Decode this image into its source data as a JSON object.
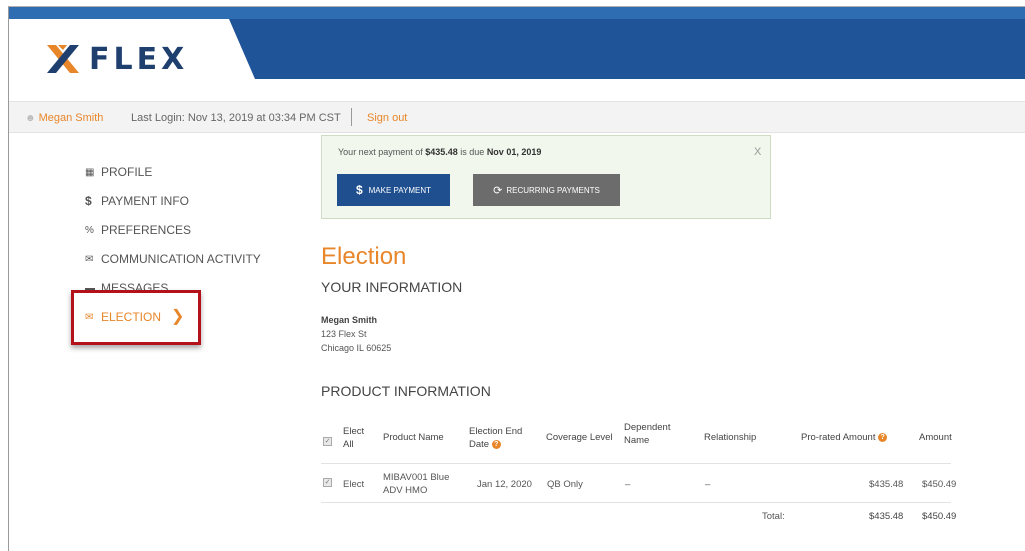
{
  "brand": {
    "name": "FLEX",
    "accent": "#e8862a",
    "navy": "#1f5499"
  },
  "user_bar": {
    "user_name": "Megan Smith",
    "last_login": "Last Login: Nov 13, 2019 at 03:34 PM CST",
    "sign_out": "Sign out"
  },
  "nav": {
    "items": [
      {
        "label": "PROFILE",
        "icon": "id-card-icon"
      },
      {
        "label": "PAYMENT INFO",
        "icon": "dollar-icon"
      },
      {
        "label": "PREFERENCES",
        "icon": "percent-icon"
      },
      {
        "label": "COMMUNICATION ACTIVITY",
        "icon": "envelope-icon"
      },
      {
        "label": "MESSAGES",
        "icon": "chat-icon"
      },
      {
        "label": "ELECTION",
        "icon": "check-envelope-icon",
        "active": true
      }
    ]
  },
  "notice": {
    "prefix": "Your next payment of ",
    "amount": "$435.48",
    "middle": " is due ",
    "due_date": "Nov 01, 2019",
    "close": "X",
    "make_payment": "MAKE PAYMENT",
    "recurring": "RECURRING PAYMENTS"
  },
  "page_title": "Election",
  "your_info": {
    "heading": "YOUR INFORMATION",
    "name": "Megan Smith",
    "street": "123 Flex St",
    "city": "Chicago IL 60625"
  },
  "product_info": {
    "heading": "PRODUCT INFORMATION",
    "headers": {
      "elect_all_1": "Elect",
      "elect_all_2": "All",
      "product_name": "Product Name",
      "end_date_1": "Election End",
      "end_date_2": "Date",
      "coverage": "Coverage Level",
      "dependent_1": "Dependent",
      "dependent_2": "Name",
      "relationship": "Relationship",
      "prorated": "Pro-rated Amount",
      "amount": "Amount"
    },
    "rows": [
      {
        "elect": "Elect",
        "product_1": "MIBAV001 Blue",
        "product_2": "ADV HMO",
        "end_date": "Jan 12, 2020",
        "coverage": "QB Only",
        "dependent": "–",
        "relationship": "–",
        "prorated": "$435.48",
        "amount": "$450.49"
      }
    ],
    "total_label": "Total:",
    "total_prorated": "$435.48",
    "total_amount": "$450.49"
  }
}
